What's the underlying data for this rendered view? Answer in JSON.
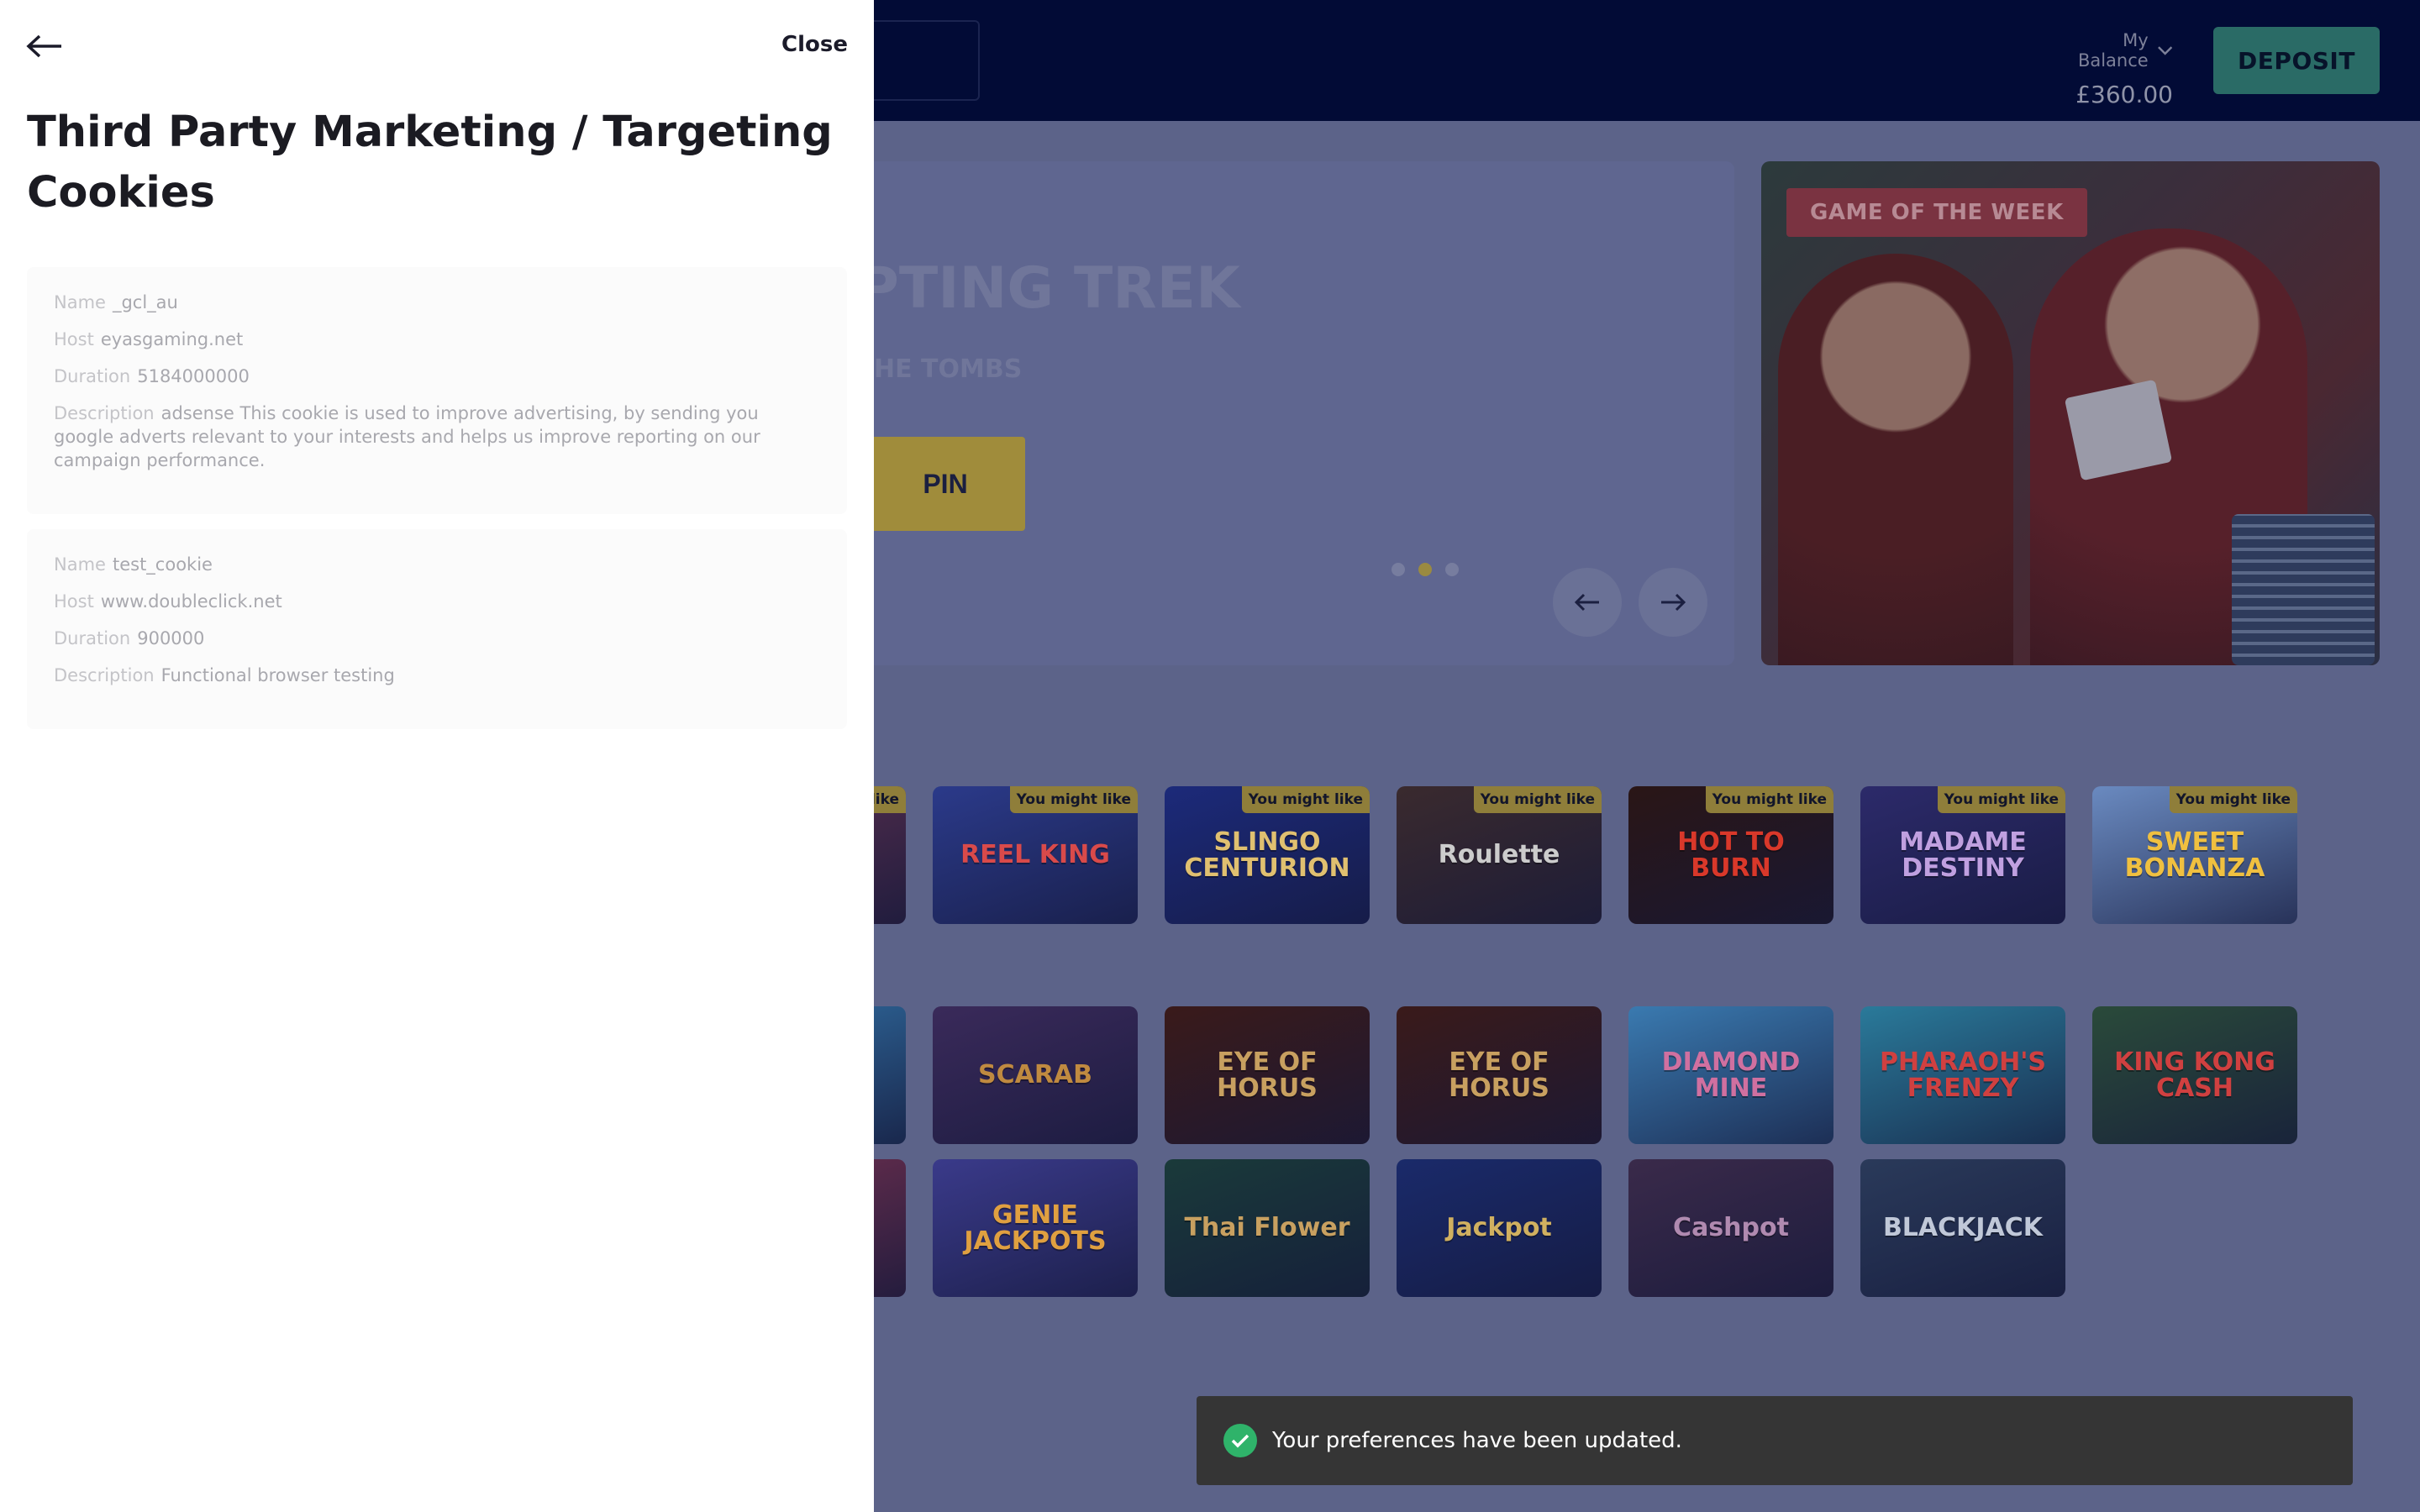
{
  "header": {
    "balance_label": "My Balance",
    "balance_value": "£360.00",
    "deposit_label": "DEPOSIT"
  },
  "hero": {
    "title_fragment": "PTING TREK",
    "subtitle_fragment": "HE TOMBS",
    "button_fragment": "PIN",
    "slide_count": 3,
    "active_slide": 2
  },
  "game_of_week": {
    "badge": "GAME OF THE WEEK"
  },
  "row1": [
    {
      "name": "",
      "badge": "like",
      "color": "#4a2a4a"
    },
    {
      "name": "REEL KING",
      "badge": "You might like",
      "color": "#2b3a8a",
      "text": "#d94a4a"
    },
    {
      "name": "SLINGO CENTURION",
      "badge": "You might like",
      "color": "#1c2a7a",
      "text": "#e0c070"
    },
    {
      "name": "Roulette",
      "badge": "You might like",
      "color": "#3a2a2e",
      "text": "#cccccc"
    },
    {
      "name": "HOT TO BURN",
      "badge": "You might like",
      "color": "#2a1616",
      "text": "#d9382a"
    },
    {
      "name": "MADAME DESTINY",
      "badge": "You might like",
      "color": "#2c2a6a",
      "text": "#c0a0e0"
    },
    {
      "name": "SWEET BONANZA",
      "badge": "You might like",
      "color": "#6a8ac0",
      "text": "#f0c040"
    }
  ],
  "row2": [
    {
      "name": "",
      "color": "#2a5a8a"
    },
    {
      "name": "SCARAB",
      "color": "#3a2a5a",
      "text": "#c08a40"
    },
    {
      "name": "EYE OF HORUS",
      "color": "#3a1a1a",
      "text": "#c8a060"
    },
    {
      "name": "EYE OF HORUS",
      "color": "#3a1a1a",
      "text": "#c8a060"
    },
    {
      "name": "DIAMOND MINE",
      "color": "#3a7ab0",
      "text": "#d070a0"
    },
    {
      "name": "PHARAOH'S FRENZY",
      "color": "#2a7a9a",
      "text": "#d04040"
    },
    {
      "name": "KING KONG CASH",
      "color": "#2a4a3a",
      "text": "#d04040"
    }
  ],
  "row3": [
    {
      "name": "",
      "color": "#5a2a4a"
    },
    {
      "name": "GENIE JACKPOTS",
      "color": "#3a3a8a",
      "text": "#e0a040"
    },
    {
      "name": "Thai Flower",
      "color": "#1a3a3a",
      "text": "#c8a060"
    },
    {
      "name": "Jackpot",
      "color": "#1a2a6a",
      "text": "#d0b060"
    },
    {
      "name": "Cashpot",
      "color": "#3a2a4a",
      "text": "#b08ab0"
    },
    {
      "name": "BLACKJACK",
      "color": "#2a3a5a",
      "text": "#c0c8d8"
    }
  ],
  "drawer": {
    "close_label": "Close",
    "title": "Third Party Marketing / Targeting Cookies",
    "cookies": [
      {
        "name_label": "Name",
        "name": "_gcl_au",
        "host_label": "Host",
        "host": "eyasgaming.net",
        "duration_label": "Duration",
        "duration": "5184000000",
        "description_label": "Description",
        "description": "adsense This cookie is used to improve advertising, by sending you google adverts relevant to your interests and helps us improve reporting on our campaign performance."
      },
      {
        "name_label": "Name",
        "name": "test_cookie",
        "host_label": "Host",
        "host": "www.doubleclick.net",
        "duration_label": "Duration",
        "duration": "900000",
        "description_label": "Description",
        "description": "Functional browser testing"
      }
    ]
  },
  "toast": {
    "message": "Your preferences have been updated."
  },
  "colors": {
    "topbar": "#020b36",
    "deposit": "#2a6b66",
    "toast_bg": "#353535",
    "toast_check": "#2fb36a"
  }
}
